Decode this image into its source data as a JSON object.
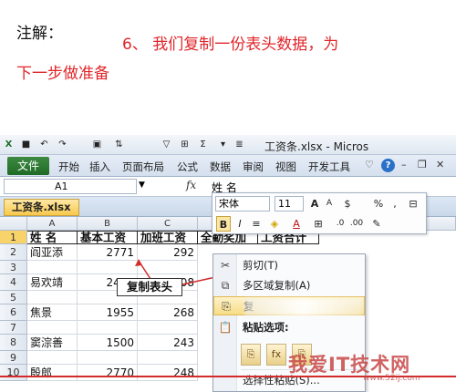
{
  "note": {
    "label": "注解：",
    "line1": "6、 我们复制一份表头数据，为",
    "line2": "下一步做准备"
  },
  "window": {
    "title": "工资条.xlsx - Micros"
  },
  "ribbon": {
    "file_tab": "文件",
    "tabs": [
      "开始",
      "插入",
      "页面布局",
      "公式",
      "数据",
      "审阅",
      "视图",
      "开发工具"
    ]
  },
  "formula_bar": {
    "name_box": "A1",
    "fx": "fx",
    "content": "姓 名"
  },
  "workbook_tab": "工资条.xlsx",
  "columns": [
    "A",
    "B",
    "C"
  ],
  "rows": [
    {
      "n": "1",
      "a": "姓 名",
      "b": "基本工资",
      "c": "加班工资",
      "d": "全勤奖加",
      "e": "工资合计"
    },
    {
      "n": "2",
      "a": "阎亚添",
      "b": "2771",
      "c": "292"
    },
    {
      "n": "3",
      "a": "",
      "b": "",
      "c": ""
    },
    {
      "n": "4",
      "a": "易欢靖",
      "b": "2470",
      "c": "208"
    },
    {
      "n": "5",
      "a": "",
      "b": "",
      "c": ""
    },
    {
      "n": "6",
      "a": "焦景",
      "b": "1955",
      "c": "268"
    },
    {
      "n": "7",
      "a": "",
      "b": "",
      "c": ""
    },
    {
      "n": "8",
      "a": "窦淙善",
      "b": "1500",
      "c": "243"
    },
    {
      "n": "9",
      "a": "",
      "b": "",
      "c": ""
    },
    {
      "n": "10",
      "a": "殷郎",
      "b": "2770",
      "c": "248"
    }
  ],
  "mini_toolbar": {
    "font": "宋体",
    "size": "11",
    "bold": "B",
    "italic": "I",
    "percent": "%"
  },
  "context_menu": {
    "cut": "剪切(T)",
    "multi_copy": "多区域复制(A)",
    "copy": "复",
    "paste_options": "粘贴选项:",
    "paste_special": "选择性粘贴(S)..."
  },
  "callout": "复制表头",
  "watermark": {
    "text": "我爱IT技术网",
    "url": "www.52ij.com"
  },
  "colors": {
    "note_red": "#e0262a",
    "file_green": "#2e7d32",
    "arrow_red": "#d32b2b"
  }
}
